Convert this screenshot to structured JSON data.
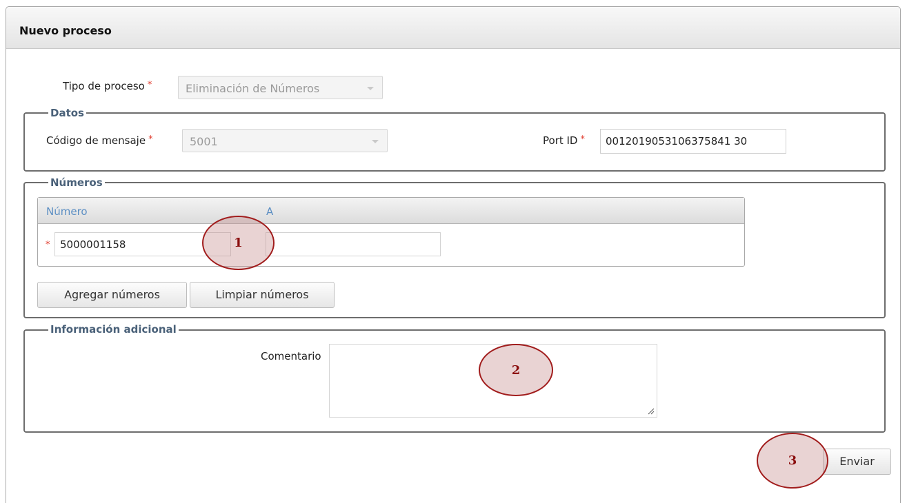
{
  "panel": {
    "title": "Nuevo proceso"
  },
  "tipo_proceso": {
    "label": "Tipo de proceso",
    "required_mark": "*",
    "value": "Eliminación de Números"
  },
  "datos": {
    "legend": "Datos",
    "codigo_label": "Código de mensaje",
    "codigo_value": "5001",
    "port_label": "Port ID",
    "port_value": "0012019053106375841 30"
  },
  "numeros": {
    "legend": "Números",
    "columns": [
      "Número",
      "A"
    ],
    "row": {
      "numero": "5000001158",
      "a": ""
    },
    "add_button": "Agregar números",
    "clear_button": "Limpiar números"
  },
  "info": {
    "legend": "Información adicional",
    "comentario_label": "Comentario",
    "comentario_value": ""
  },
  "submit_button": "Enviar",
  "markers": [
    "1",
    "2",
    "3"
  ],
  "colors": {
    "required": "#e0392b",
    "legend": "#4a6179",
    "column_header": "#5b8ec3",
    "marker_border": "#a11c1c",
    "marker_text": "#8b0f0f"
  }
}
